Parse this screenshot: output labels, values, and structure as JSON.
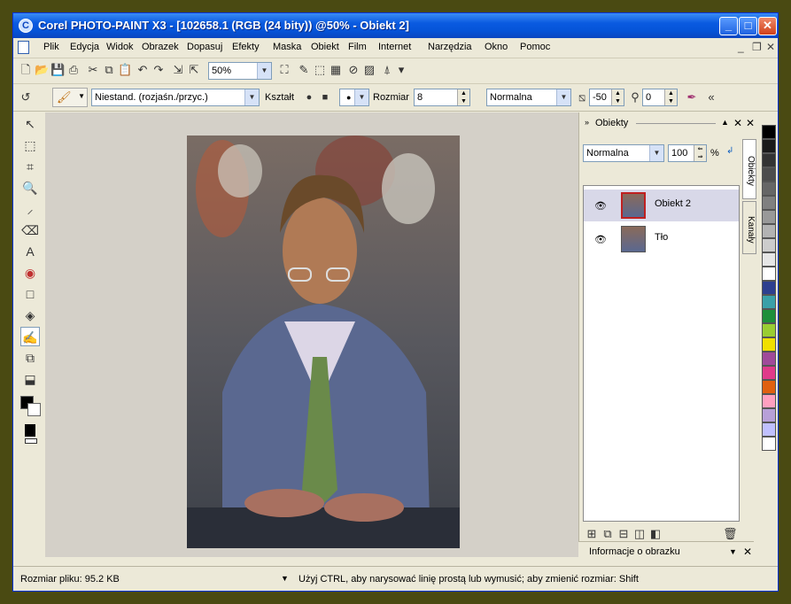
{
  "window": {
    "title": "Corel PHOTO-PAINT X3 - [102658.1 (RGB (24 bity)) @50% - Obiekt 2]",
    "controls": {
      "minimize": "_",
      "maximize": "□",
      "close": "✕"
    }
  },
  "menu": {
    "items": [
      "Plik",
      "Edycja",
      "Widok",
      "Obrazek",
      "Dopasuj",
      "Efekty",
      "Maska",
      "Obiekt",
      "Film",
      "Internet",
      "Narzędzia",
      "Okno",
      "Pomoc"
    ],
    "mdi_controls": {
      "minimize": "_",
      "restore": "❐",
      "close": "✕"
    }
  },
  "toolbar": {
    "zoom_value": "50%"
  },
  "property_bar": {
    "brush_type": "Niestand. (rozjaśn./przyc.)",
    "shape_label": "Kształt",
    "size_label": "Rozmiar",
    "size_value": "8",
    "merge_mode": "Normalna",
    "transparency_value": "-50",
    "feather_value": "0"
  },
  "docker": {
    "title": "Obiekty",
    "blend_mode": "Normalna",
    "opacity_value": "100",
    "opacity_unit": "%",
    "tabs": {
      "objects": "Obiekty",
      "channels": "Kanały"
    },
    "layers": [
      {
        "name": "Obiekt 2",
        "selected": true
      },
      {
        "name": "Tło",
        "selected": false
      }
    ],
    "info_panel_title": "Informacje o obrazku"
  },
  "status": {
    "file_size": "Rozmiar pliku: 95.2 KB",
    "hint": "Użyj CTRL, aby narysować linię prostą lub wymusić; aby zmienić rozmiar: Shift"
  },
  "palette": [
    "#000000",
    "#1a1a1a",
    "#333333",
    "#4d4d4d",
    "#666666",
    "#808080",
    "#999999",
    "#b3b3b3",
    "#cccccc",
    "#e6e6e6",
    "#ffffff",
    "#2e3f8f",
    "#3aa0a8",
    "#1e8f3a",
    "#9acd32",
    "#f0e000",
    "#a04a9a",
    "#e03a8a",
    "#e06010",
    "#ffa0c0",
    "#b8a0d8",
    "#c0c0ff",
    "#ffffff"
  ],
  "colors": {
    "title_bar": "#0a5ae0",
    "background": "#4a4a12",
    "selected_layer": "#d8d8e8"
  }
}
